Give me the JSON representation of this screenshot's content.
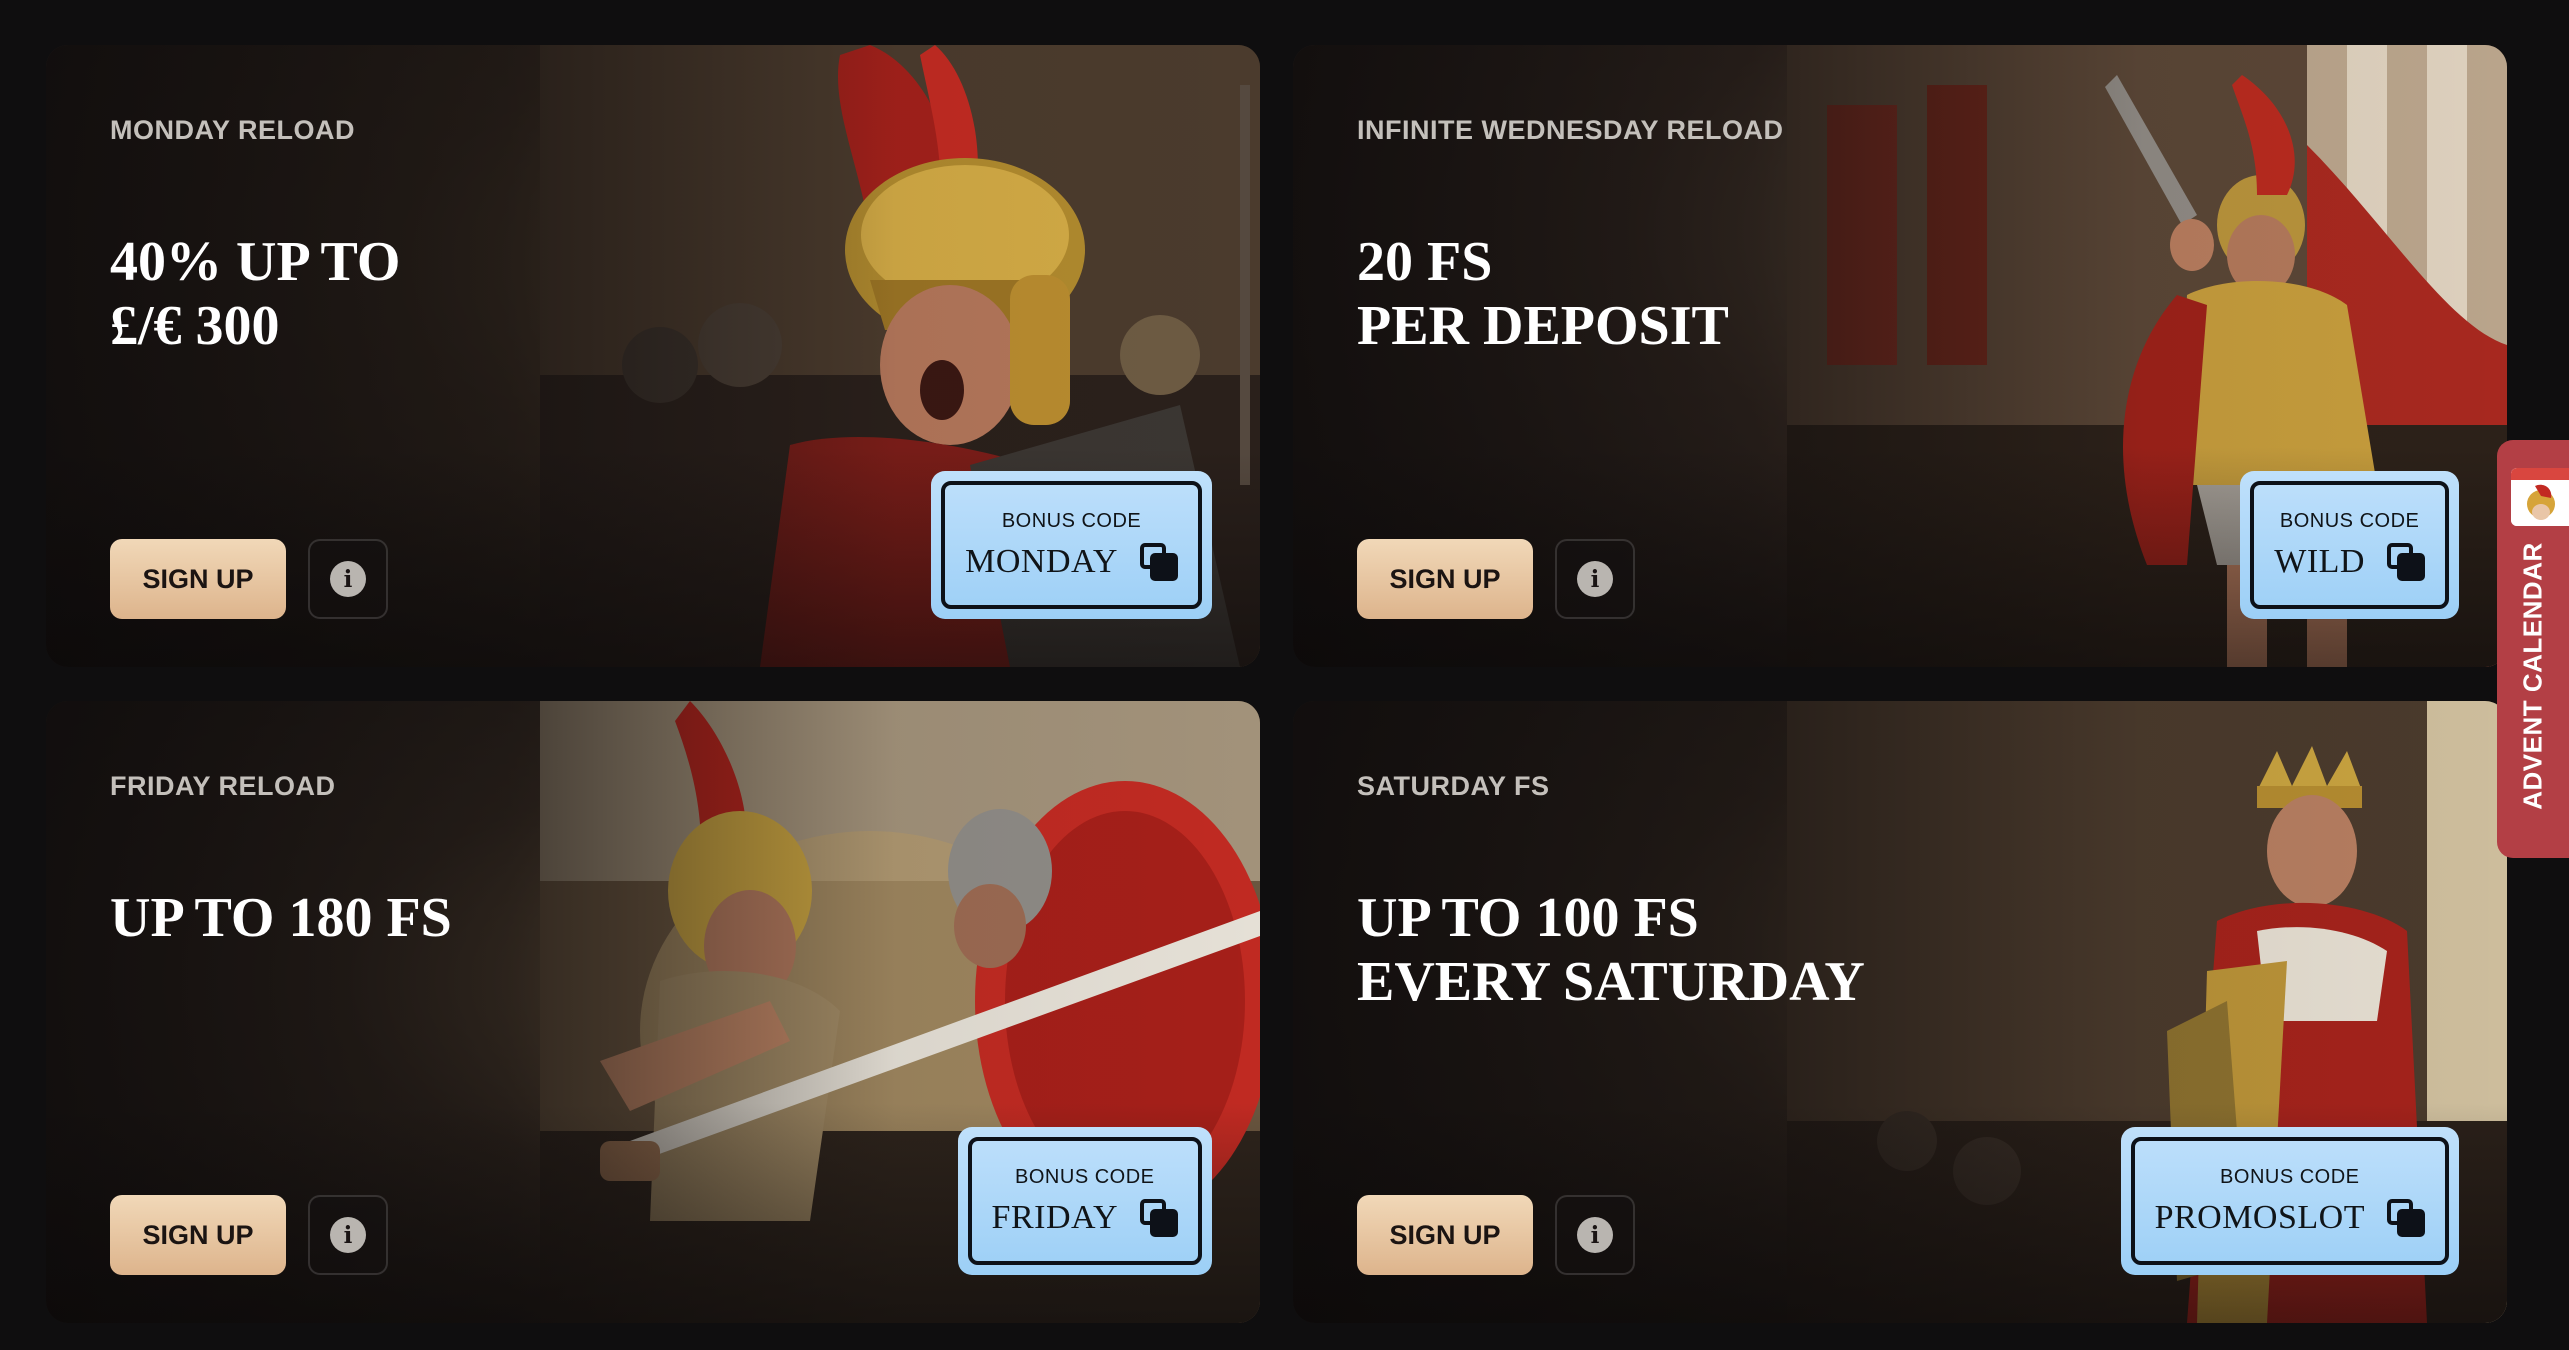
{
  "cards": [
    {
      "label": "MONDAY RELOAD",
      "headline": [
        "40% UP TO",
        "£/€ 300"
      ],
      "signup_label": "SIGN UP",
      "info_icon": "i",
      "bonus_code_title": "BONUS CODE",
      "bonus_code": "MONDAY",
      "art_theme": "roman-warrior-shouting-red-plume"
    },
    {
      "label": "INFINITE WEDNESDAY RELOAD",
      "headline": [
        "20 FS",
        "PER DEPOSIT"
      ],
      "signup_label": "SIGN UP",
      "info_icon": "i",
      "bonus_code_title": "BONUS CODE",
      "bonus_code": "WILD",
      "art_theme": "roman-general-raising-sword"
    },
    {
      "label": "FRIDAY RELOAD",
      "headline": [
        "UP TO 180 FS"
      ],
      "signup_label": "SIGN UP",
      "info_icon": "i",
      "bonus_code_title": "BONUS CODE",
      "bonus_code": "FRIDAY",
      "art_theme": "gladiators-fighting-with-sword"
    },
    {
      "label": "SATURDAY FS",
      "headline": [
        "UP TO 100 FS",
        "EVERY SATURDAY"
      ],
      "signup_label": "SIGN UP",
      "info_icon": "i",
      "bonus_code_title": "BONUS CODE",
      "bonus_code": "PROMOSLOT",
      "art_theme": "emperor-with-crown-and-red-cape"
    }
  ],
  "advent_calendar": {
    "label": "ADVENT CALENDAR"
  },
  "colors": {
    "page_background": "#0f0e0f",
    "signup_gradient_top": "#f1d8b8",
    "signup_gradient_bottom": "#ddb48c",
    "bonus_code_background": "#a9d6f8",
    "advent_tab": "#b33f45"
  }
}
